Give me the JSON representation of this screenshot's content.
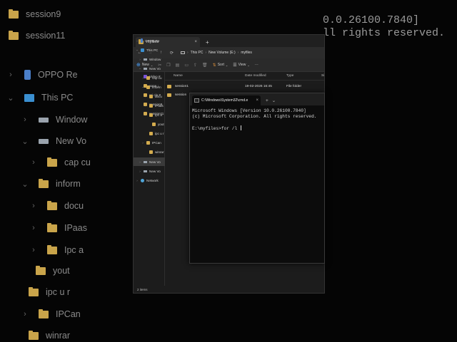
{
  "background": {
    "tree": [
      {
        "label": "session9",
        "icon": "folder-icon"
      },
      {
        "label": "session11",
        "icon": "folder-icon"
      },
      {
        "label": "OPPO Re",
        "icon": "phone-icon"
      },
      {
        "label": "This PC",
        "icon": "pc-icon"
      },
      {
        "label": "Window",
        "icon": "drive-icon"
      },
      {
        "label": "New Vo",
        "icon": "drive-icon"
      },
      {
        "label": "cap cu",
        "icon": "folder-icon"
      },
      {
        "label": "inform",
        "icon": "folder-icon"
      },
      {
        "label": "docu",
        "icon": "folder-icon"
      },
      {
        "label": "IPaas",
        "icon": "folder-icon"
      },
      {
        "label": "Ipc a",
        "icon": "folder-icon"
      },
      {
        "label": "yout",
        "icon": "folder-icon"
      },
      {
        "label": "ipc u r",
        "icon": "folder-icon"
      },
      {
        "label": "IPCan",
        "icon": "folder-icon"
      },
      {
        "label": "winrar",
        "icon": "folder-icon"
      }
    ],
    "cmd_lines": [
      "0.0.26100.7840]",
      "ll rights reserved."
    ]
  },
  "explorer": {
    "tab_title": "myfiles",
    "new_tab": "+",
    "nav": {
      "back": "←",
      "forward": "→",
      "up": "↑",
      "refresh": "⟳"
    },
    "breadcrumb": [
      "This PC",
      "New Volume (E:)",
      "myfiles"
    ],
    "toolbar": {
      "new_label": "New",
      "sort_label": "Sort",
      "view_label": "View",
      "more": "···"
    },
    "quick_access": [
      {
        "label": "Video #",
        "icon": "video-icon"
      },
      {
        "label": "aaaa ¡",
        "icon": "folder-icon"
      },
      {
        "label": "raj clo #",
        "icon": "folder-icon"
      },
      {
        "label": "session9",
        "icon": "folder-icon"
      },
      {
        "label": "session11",
        "icon": "folder-icon"
      }
    ],
    "tree": [
      {
        "label": "OPPO Re",
        "icon": "phone-icon",
        "chev": "›"
      },
      {
        "label": "This PC",
        "icon": "pc-icon",
        "chev": "⌄"
      },
      {
        "label": "Window",
        "icon": "drive-icon",
        "chev": "›"
      },
      {
        "label": "New Vo",
        "icon": "drive-icon",
        "chev": "⌄"
      },
      {
        "label": "cap cu",
        "icon": "folder-icon",
        "chev": "›"
      },
      {
        "label": "inform",
        "icon": "folder-icon",
        "chev": "⌄"
      },
      {
        "label": "docu",
        "icon": "folder-icon",
        "chev": "›"
      },
      {
        "label": "IPaas",
        "icon": "folder-icon",
        "chev": "›"
      },
      {
        "label": "Ipc a",
        "icon": "folder-icon",
        "chev": "›"
      },
      {
        "label": "yout",
        "icon": "folder-icon",
        "chev": ""
      },
      {
        "label": "ipc u r",
        "icon": "folder-icon",
        "chev": ""
      },
      {
        "label": "IPCan",
        "icon": "folder-icon",
        "chev": "›"
      },
      {
        "label": "winrar",
        "icon": "folder-icon",
        "chev": ""
      },
      {
        "label": "New Vo",
        "icon": "drive-icon",
        "chev": "›"
      },
      {
        "label": "New Vo",
        "icon": "drive-icon",
        "chev": "›"
      },
      {
        "label": "Network",
        "icon": "network-icon",
        "chev": "›"
      }
    ],
    "columns": {
      "name": "Name",
      "date": "Date modified",
      "type": "Type",
      "size": "Si"
    },
    "files": [
      {
        "name": "session1",
        "date": "19-02-2026 16:45",
        "type": "File folder"
      },
      {
        "name": "session",
        "date": "",
        "type": ""
      }
    ],
    "status": "2 items"
  },
  "cmd": {
    "tab_title": "C:\\Windows\\System32\\cmd.e",
    "tab_close": "×",
    "new_tab": "+",
    "dropdown": "⌄",
    "lines": [
      "Microsoft Windows [Version 10.0.26100.7840]",
      "(c) Microsoft Corporation. All rights reserved.",
      "",
      "E:\\myfiles>for /l "
    ]
  }
}
